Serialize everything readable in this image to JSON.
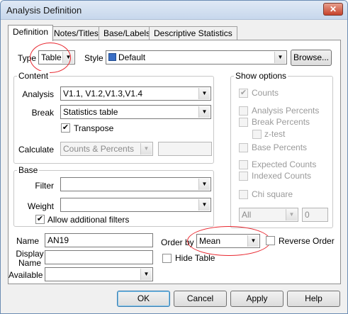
{
  "window": {
    "title": "Analysis Definition",
    "close_label": "✕"
  },
  "tabs": [
    "Definition",
    "Notes/Titles",
    "Base/Labels",
    "Descriptive Statistics"
  ],
  "top": {
    "type_label": "Type",
    "type_value": "Table",
    "style_label": "Style",
    "style_value": "Default",
    "browse_label": "Browse..."
  },
  "content": {
    "title": "Content",
    "analysis_label": "Analysis",
    "analysis_value": "V1.1, V1.2,V1.3,V1.4",
    "break_label": "Break",
    "break_value": "Statistics table",
    "transpose_label": "Transpose",
    "transpose_checked": true,
    "calculate_label": "Calculate",
    "calculate_value": "Counts & Percents"
  },
  "base": {
    "title": "Base",
    "filter_label": "Filter",
    "filter_value": "",
    "weight_label": "Weight",
    "weight_value": "",
    "allow_filters_label": "Allow additional filters",
    "allow_filters_checked": true
  },
  "show_options": {
    "title": "Show options",
    "counts": "Counts",
    "counts_checked": true,
    "analysis_percents": "Analysis Percents",
    "break_percents": "Break Percents",
    "ztest": "z-test",
    "base_percents": "Base Percents",
    "expected_counts": "Expected Counts",
    "indexed_counts": "Indexed Counts",
    "chi_square": "Chi square",
    "all_value": "All",
    "number_value": "0"
  },
  "bottom": {
    "name_label": "Name",
    "name_value": "AN19",
    "display_name_label": "Display Name",
    "available_label": "Available",
    "order_by_label": "Order by",
    "order_by_value": "Mean",
    "reverse_order_label": "Reverse Order",
    "hide_table_label": "Hide Table"
  },
  "buttons": {
    "ok": "OK",
    "cancel": "Cancel",
    "apply": "Apply",
    "help": "Help"
  },
  "check_mark": "✔",
  "dropdown_glyph": "▼"
}
